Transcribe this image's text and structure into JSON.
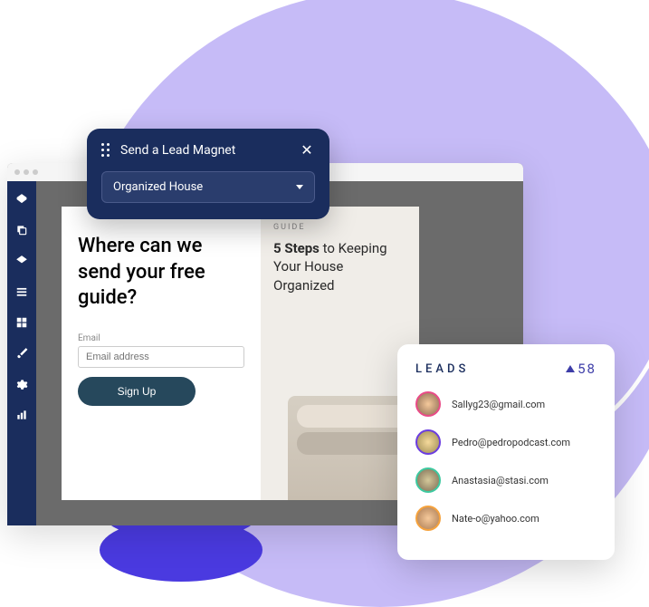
{
  "popup": {
    "title": "Send a Lead Magnet",
    "dropdown_value": "Organized House"
  },
  "sidebar": {
    "icons": [
      "layers",
      "copy",
      "layers2",
      "rows",
      "grid",
      "brush",
      "gear",
      "chart"
    ]
  },
  "form": {
    "heading": "Where can we send your free guide?",
    "email_label": "Email",
    "email_placeholder": "Email address",
    "button": "Sign Up"
  },
  "guide": {
    "label": "GUIDE",
    "title_bold": "5 Steps",
    "title_rest": " to Keeping Your House Organized"
  },
  "leads": {
    "title": "LEADS",
    "count": "58",
    "items": [
      {
        "email": "Sallyg23@gmail.com"
      },
      {
        "email": "Pedro@pedropodcast.com"
      },
      {
        "email": "Anastasia@stasi.com"
      },
      {
        "email": "Nate-o@yahoo.com"
      }
    ]
  }
}
